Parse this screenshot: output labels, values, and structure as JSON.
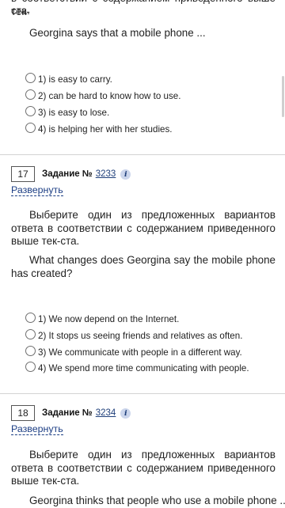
{
  "top": {
    "partial_line": "в соответствии с содержанием приведенного выше тек-",
    "end_line": "ста.",
    "question": "Georgina says that a mobile phone ...",
    "options": [
      "1) is easy to carry.",
      "2) can be hard to know how to use.",
      "3) is easy to lose.",
      "4) is helping her with her studies."
    ]
  },
  "tasks": [
    {
      "number": "17",
      "label": "Задание №",
      "id_link": "3233",
      "expand": "Развернуть",
      "instruction": "Выберите один из предложенных вариантов ответа в соответствии с содержанием приведенного выше тек-ста.",
      "question": "What changes does Georgina say the mobile phone has created?",
      "options": [
        "1) We now depend on the Internet.",
        "2) It stops us seeing friends and relatives as often.",
        "3) We communicate with people in a different way.",
        "4) We spend more time communicating with people."
      ]
    },
    {
      "number": "18",
      "label": "Задание №",
      "id_link": "3234",
      "expand": "Развернуть",
      "instruction": "Выберите один из предложенных вариантов ответа в соответствии с содержанием приведенного выше тек-ста.",
      "question": "Georgina thinks that people who use a mobile phone ..."
    }
  ],
  "info_icon_glyph": "i",
  "colors": {
    "link": "#1c3e84",
    "info_bg": "#ccd6ec",
    "divider": "#d3d3d3"
  }
}
